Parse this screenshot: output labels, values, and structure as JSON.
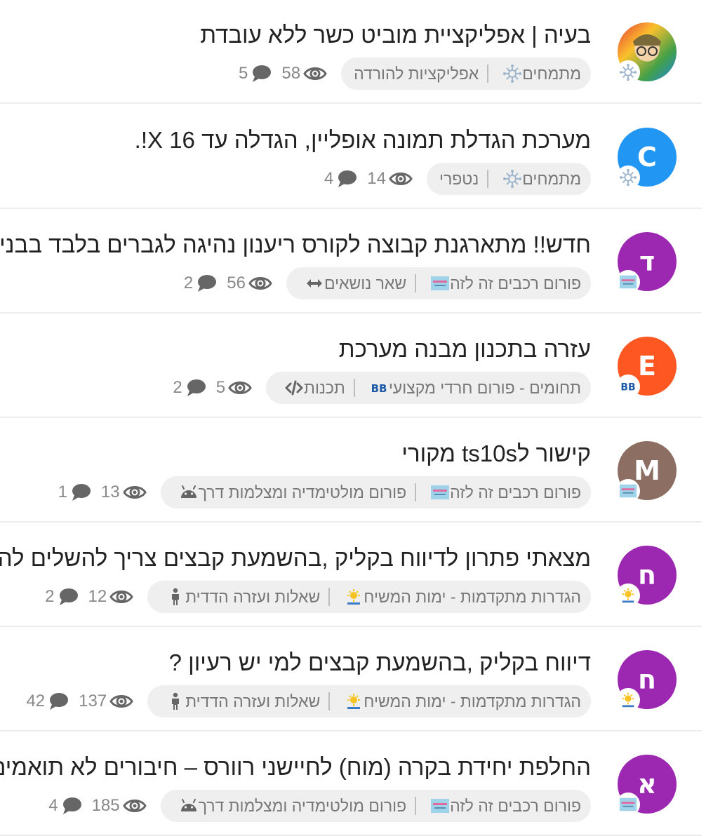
{
  "topics": [
    {
      "title": "בעיה | אפליקציית מוביט כשר ללא עובדת",
      "avatar_letter": "",
      "avatar_color": "#4caf50",
      "avatar_type": "photo",
      "badge_icon": "circuit-icon",
      "categories": [
        "מתמחים",
        "אפליקציות להורדה"
      ],
      "category_icons": [
        "circuit-icon",
        ""
      ],
      "views": "58",
      "comments": "5"
    },
    {
      "title": "מערכת הגדלת תמונה אופליין, הגדלה עד 16 X!.",
      "avatar_letter": "C",
      "avatar_color": "#2196f3",
      "badge_icon": "circuit-icon",
      "categories": [
        "מתמחים",
        "נטפרי"
      ],
      "category_icons": [
        "circuit-icon",
        ""
      ],
      "views": "14",
      "comments": "4"
    },
    {
      "title": "חדש!! מתארגנת קבוצה לקורס ריענון נהיגה לגברים בלבד בבני ברק",
      "avatar_letter": "ד",
      "avatar_color": "#9c27b0",
      "badge_icon": "cars-forum-logo",
      "categories": [
        "פורום רכבים זה לזה",
        "שאר נושאים"
      ],
      "category_icons": [
        "cars-forum-logo",
        "arrows-h-icon"
      ],
      "views": "56",
      "comments": "2"
    },
    {
      "title": "עזרה בתכנון מבנה מערכת",
      "avatar_letter": "E",
      "avatar_color": "#ff5722",
      "badge_icon": "bb-logo",
      "categories": [
        "תחומים - פורום חרדי מקצועי",
        "תכנות"
      ],
      "category_icons": [
        "bb-logo",
        "code-icon"
      ],
      "views": "5",
      "comments": "2"
    },
    {
      "title": "קישור לts10s מקורי",
      "avatar_letter": "M",
      "avatar_color": "#8d6e63",
      "badge_icon": "cars-forum-logo",
      "categories": [
        "פורום רכבים זה לזה",
        "פורום מולטימדיה ומצלמות דרך"
      ],
      "category_icons": [
        "cars-forum-logo",
        "android-icon"
      ],
      "views": "13",
      "comments": "1"
    },
    {
      "title": "מצאתי פתרון לדיווח בקליק ,בהשמעת קבצים צריך להשלים להגדיר",
      "avatar_letter": "ח",
      "avatar_color": "#9c27b0",
      "badge_icon": "messiah-days-logo",
      "categories": [
        "הגדרות מתקדמות - ימות המשיח",
        "שאלות ועזרה הדדית"
      ],
      "category_icons": [
        "messiah-days-logo",
        "person-icon"
      ],
      "views": "12",
      "comments": "2"
    },
    {
      "title": "דיווח בקליק ,בהשמעת קבצים למי יש רעיון ?",
      "avatar_letter": "ח",
      "avatar_color": "#9c27b0",
      "badge_icon": "messiah-days-logo",
      "categories": [
        "הגדרות מתקדמות - ימות המשיח",
        "שאלות ועזרה הדדית"
      ],
      "category_icons": [
        "messiah-days-logo",
        "person-icon"
      ],
      "views": "137",
      "comments": "42"
    },
    {
      "title": "החלפת יחידת בקרה (מוח) לחיישני רוורס – חיבורים לא תואמים",
      "avatar_letter": "א",
      "avatar_color": "#9c27b0",
      "badge_icon": "cars-forum-logo",
      "categories": [
        "פורום רכבים זה לזה",
        "פורום מולטימדיה ומצלמות דרך"
      ],
      "category_icons": [
        "cars-forum-logo",
        "android-icon"
      ],
      "views": "185",
      "comments": "4"
    }
  ],
  "colors": {
    "icon_gray": "#666666",
    "circuit_blue": "#9fb6cc",
    "bb_blue": "#1e5aa8"
  }
}
